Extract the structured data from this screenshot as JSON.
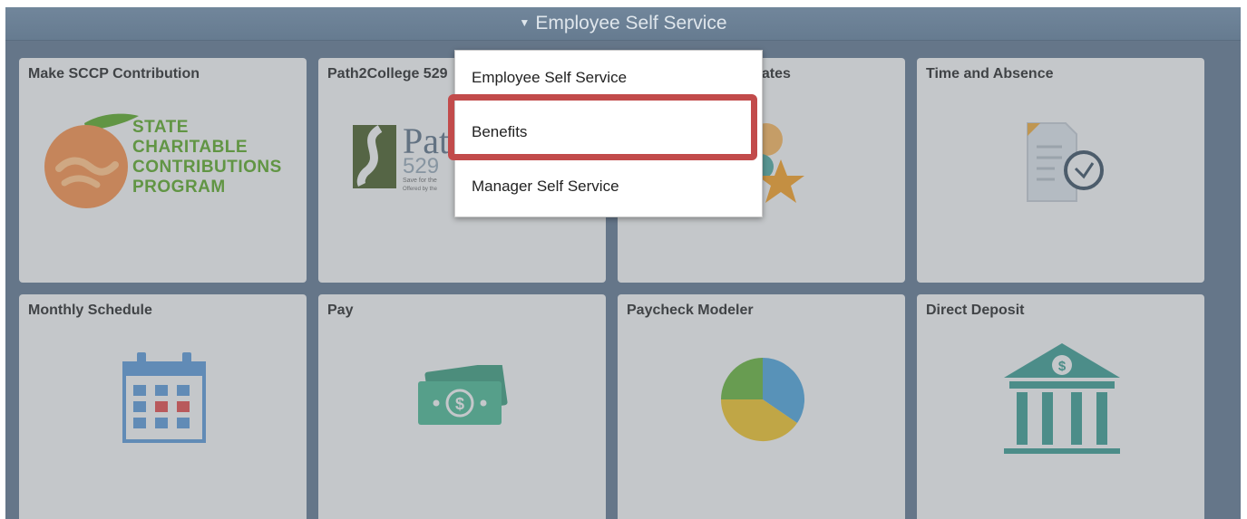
{
  "header": {
    "title": "Employee Self Service",
    "caret_icon": "caret-down-icon"
  },
  "tiles": [
    {
      "id": "sccp",
      "title": "Make SCCP Contribution",
      "logo_text": [
        "STATE",
        "CHARITABLE",
        "CONTRIBUTIONS",
        "PROGRAM"
      ]
    },
    {
      "id": "path2college",
      "title": "Path2College 529",
      "logo_text": "Path",
      "logo_number": "529",
      "logo_sub1": "Save for the",
      "logo_sub2": "Offered by the"
    },
    {
      "id": "certificates",
      "title": "cates"
    },
    {
      "id": "time-absence",
      "title": "Time and Absence"
    },
    {
      "id": "monthly-schedule",
      "title": "Monthly Schedule"
    },
    {
      "id": "pay",
      "title": "Pay",
      "bill_symbol": "$"
    },
    {
      "id": "paycheck-modeler",
      "title": "Paycheck Modeler"
    },
    {
      "id": "direct-deposit",
      "title": "Direct Deposit",
      "bank_symbol": "$"
    }
  ],
  "menu": {
    "items": [
      {
        "label": "Employee Self Service"
      },
      {
        "label": "Benefits",
        "highlighted": true
      },
      {
        "label": "Manager Self Service"
      }
    ]
  },
  "colors": {
    "header": "#6a7f94",
    "tile": "#e8e8e8",
    "highlight_border": "#c24b4b",
    "sccp_green": "#6aa83d"
  }
}
